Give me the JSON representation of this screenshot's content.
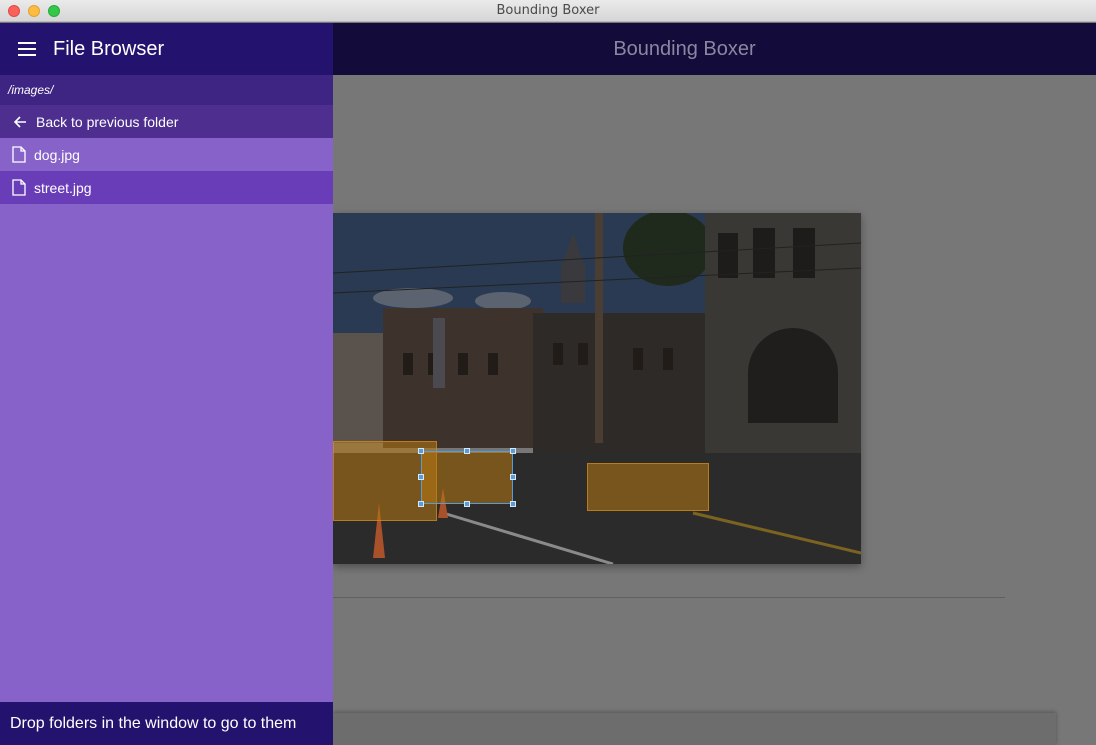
{
  "window": {
    "title": "Bounding Boxer"
  },
  "app": {
    "title": "Bounding Boxer"
  },
  "drawer": {
    "title": "File Browser",
    "current_path": "/images/",
    "back_label": "Back to previous folder",
    "files": [
      {
        "name": "dog.jpg",
        "selected": false
      },
      {
        "name": "street.jpg",
        "selected": true
      }
    ],
    "footer_text": "Drop folders in the window to go to them"
  },
  "colors": {
    "drawer_bg": "#8762c9",
    "drawer_header": "#24136e",
    "selected_file": "#6a3db8",
    "box_fill": "#b87812",
    "handle": "#5a9dd6"
  },
  "icons": [
    "menu-icon",
    "arrow-left-icon",
    "file-icon"
  ]
}
